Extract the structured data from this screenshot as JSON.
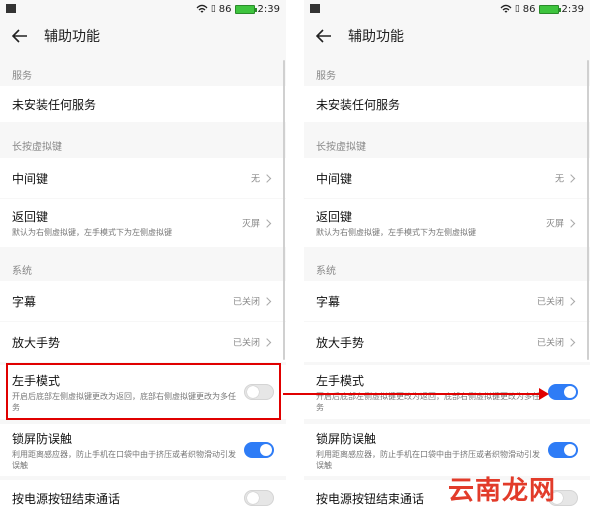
{
  "status": {
    "signal": "86",
    "time": "2:39"
  },
  "header": {
    "title": "辅助功能"
  },
  "sections": {
    "services": "服务",
    "longpress": "长按虚拟键",
    "system": "系统"
  },
  "items": {
    "no_service": {
      "title": "未安装任何服务"
    },
    "middle_key": {
      "title": "中间键",
      "value": "无"
    },
    "back_key": {
      "title": "返回键",
      "desc": "默认为右侧虚拟键，左手模式下为左侧虚拟键",
      "value": "灭屏"
    },
    "caption": {
      "title": "字幕",
      "value": "已关闭"
    },
    "magnify": {
      "title": "放大手势",
      "value": "已关闭"
    },
    "left_hand": {
      "title": "左手模式",
      "desc": "开启后底部左侧虚拟键更改为返回，底部右侧虚拟键更改为多任务"
    },
    "lock_screen": {
      "title": "锁屏防误触",
      "desc": "利用距离感应器，防止手机在口袋中由于挤压或者织物滑动引发误触"
    },
    "power_end_call": {
      "title": "按电源按钮结束通话"
    }
  },
  "toggles": {
    "left": {
      "left_hand": "off",
      "lock_screen": "on",
      "power_end_call": "off"
    },
    "right": {
      "left_hand": "on",
      "lock_screen": "on",
      "power_end_call": "off"
    }
  },
  "accent_color": "#2e7cf6",
  "annotation_color": "#e00000",
  "watermark": "云南龙网"
}
